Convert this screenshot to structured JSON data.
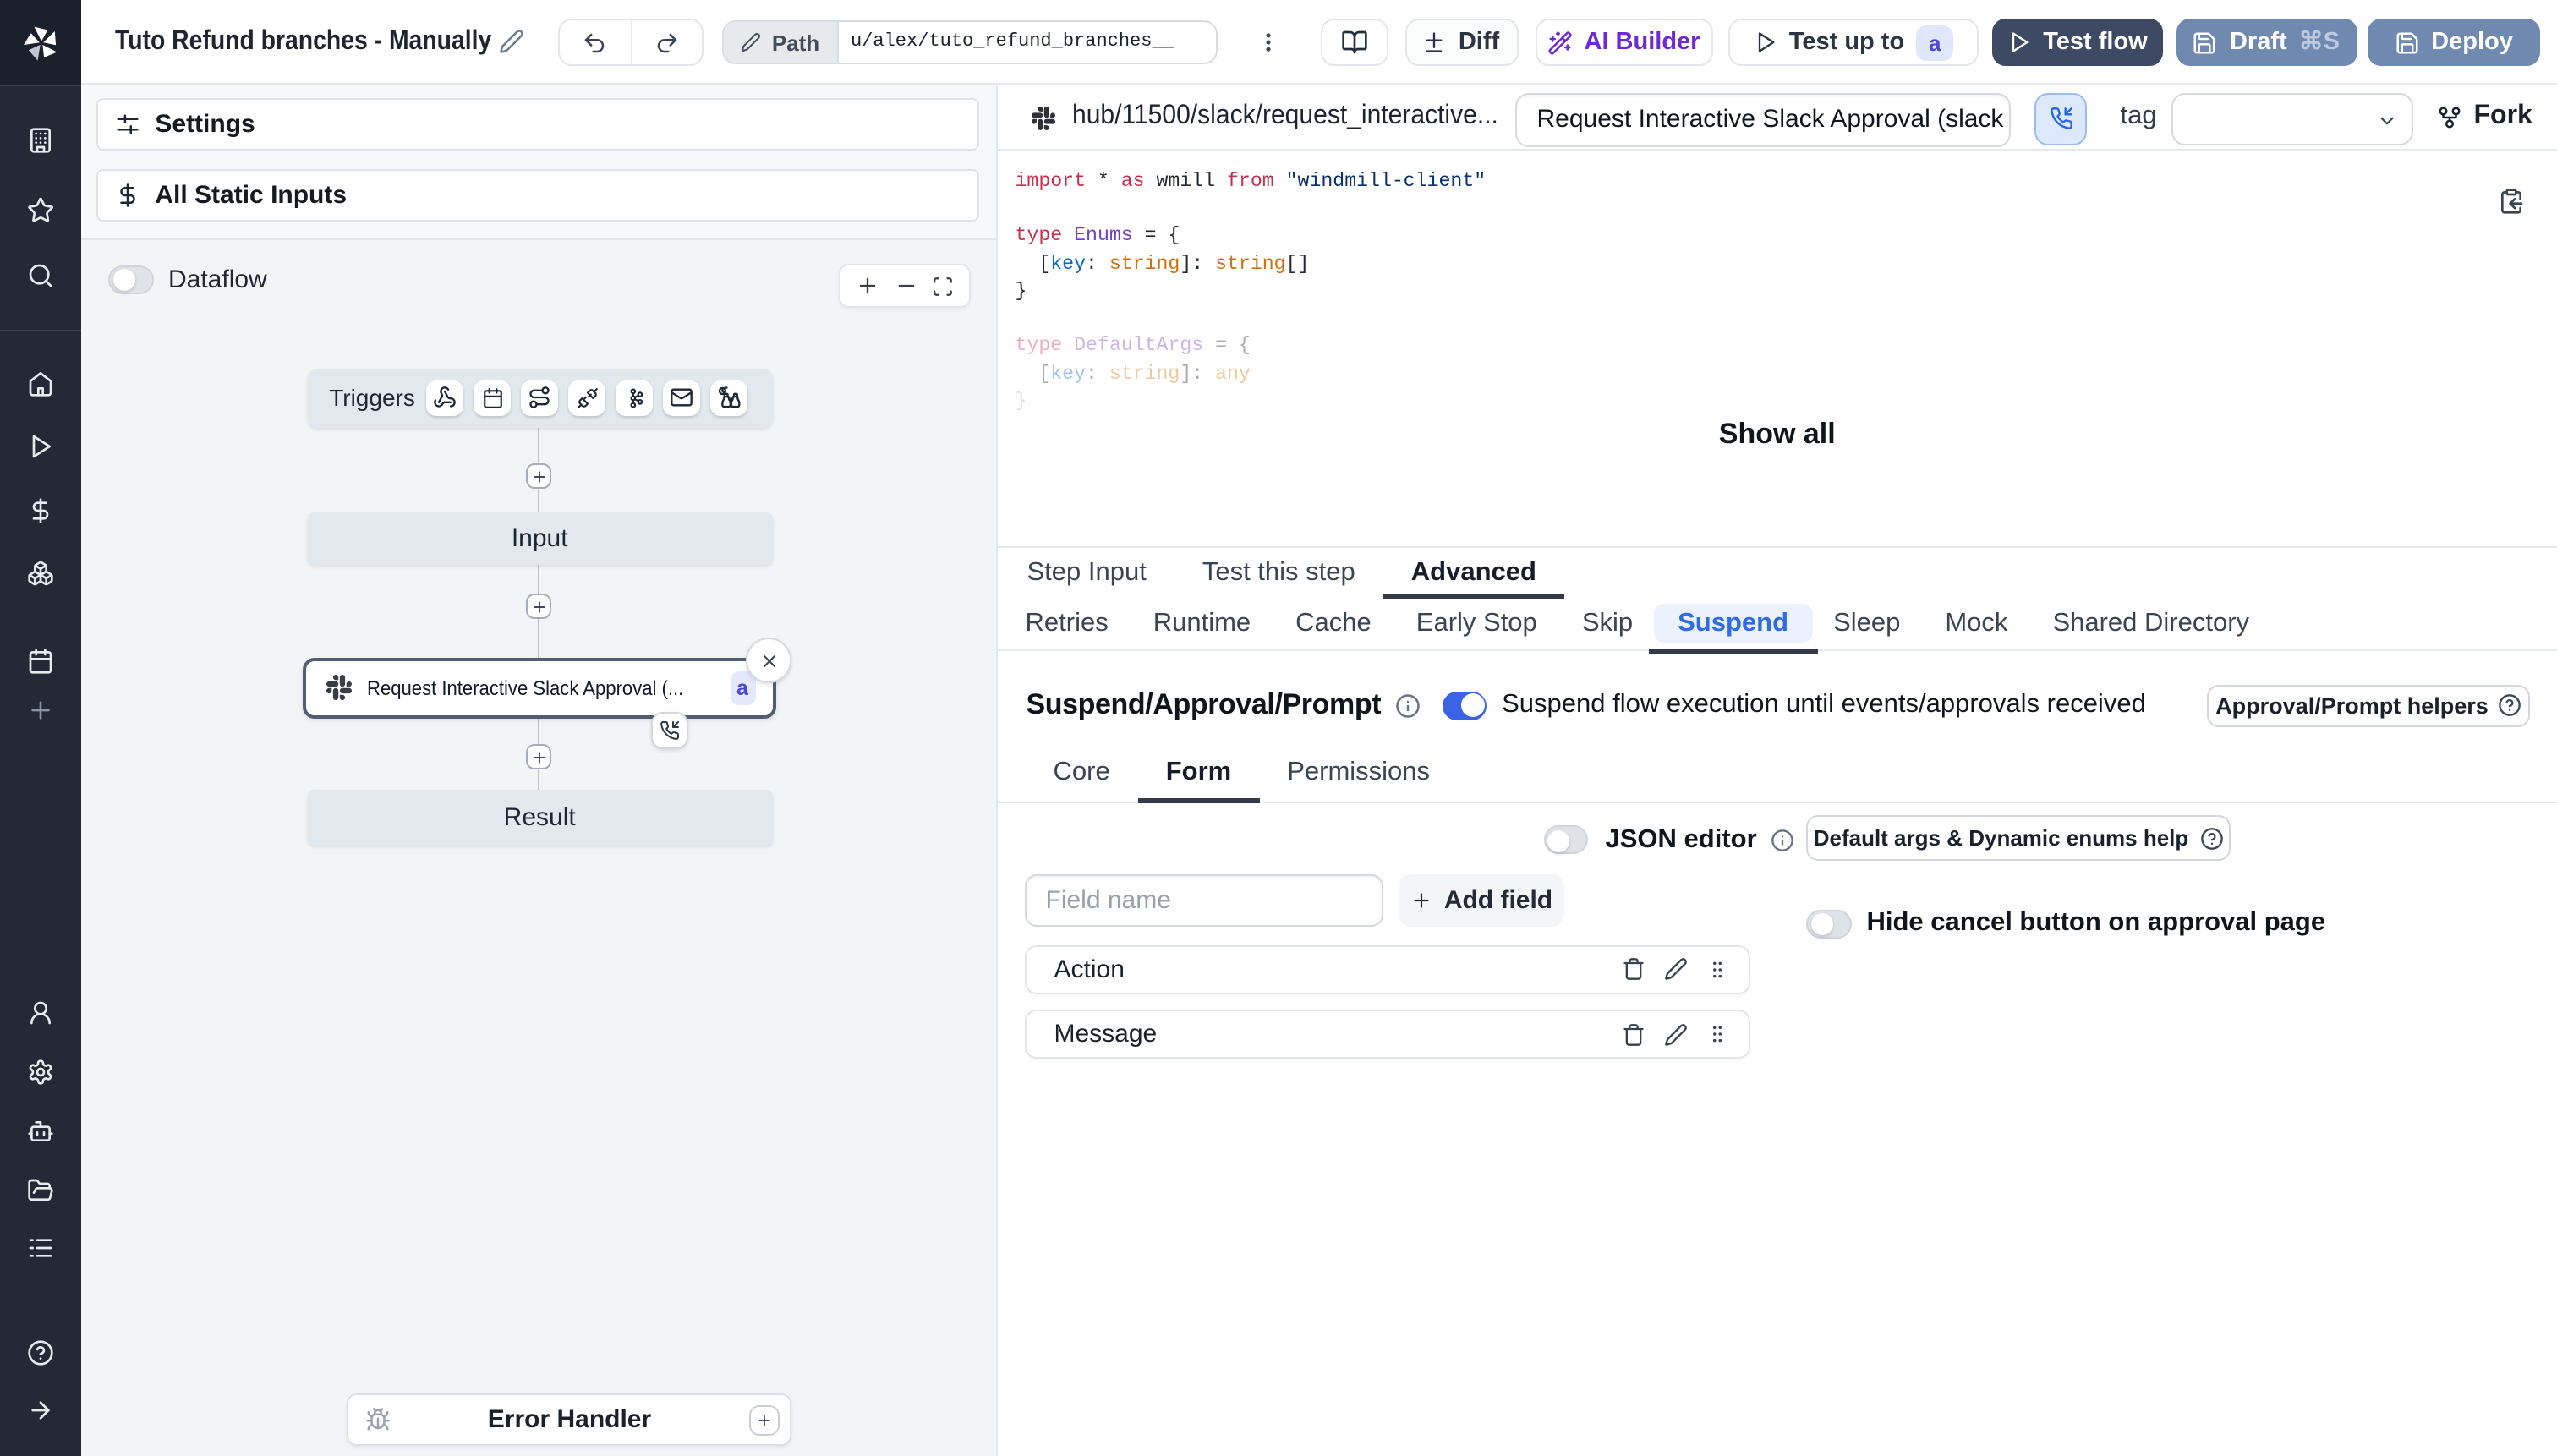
{
  "colors": {
    "accent_blue": "#3b63e5",
    "suspend_active": "#2f6be4",
    "test_flow_bg": "#3e4964",
    "draft_deploy_bg": "#7089b0",
    "sidebar_bg": "#242a35",
    "badge_indigo": "#4b48d6",
    "ai_purple": "#6d28d9"
  },
  "sidebar": {
    "items": [
      "windmill-logo",
      "workspace",
      "favorites",
      "search",
      "home",
      "runs",
      "variables",
      "resources",
      "schedules",
      "add",
      "user",
      "settings",
      "workers",
      "folders",
      "logs",
      "help",
      "expand"
    ]
  },
  "topbar": {
    "title": "Tuto Refund branches - Manually",
    "path_label": "Path",
    "path_value": "u/alex/tuto_refund_branches__",
    "diff": "Diff",
    "ai_builder": "AI Builder",
    "test_up_to": "Test up to",
    "test_up_to_badge": "a",
    "test_flow": "Test flow",
    "draft": "Draft",
    "draft_shortcut": "⌘S",
    "deploy": "Deploy"
  },
  "flow_panel": {
    "settings": "Settings",
    "all_static_inputs": "All Static Inputs",
    "dataflow": "Dataflow",
    "triggers_label": "Triggers",
    "trigger_icons": [
      "webhook",
      "schedule",
      "http-route",
      "websocket",
      "kafka",
      "email",
      "scheduled-poll"
    ],
    "input_node": "Input",
    "step_node": {
      "label": "Request Interactive Slack Approval (...",
      "badge": "a"
    },
    "result_node": "Result",
    "error_handler": "Error Handler"
  },
  "right_panel": {
    "hub_path": "hub/11500/slack/request_interactive...",
    "step_name": "Request Interactive Slack Approval (slack",
    "tag_label": "tag",
    "fork": "Fork",
    "show_all": "Show all",
    "code_lines": [
      {
        "fade": "none",
        "tokens": [
          {
            "t": "import",
            "c": "tk-k"
          },
          {
            "t": " * ",
            "c": "tk-d"
          },
          {
            "t": "as",
            "c": "tk-k"
          },
          {
            "t": " wmill ",
            "c": "tk-d"
          },
          {
            "t": "from",
            "c": "tk-k"
          },
          {
            "t": " ",
            "c": "tk-d"
          },
          {
            "t": "\"windmill-client\"",
            "c": "tk-s"
          }
        ]
      },
      {
        "fade": "none",
        "tokens": []
      },
      {
        "fade": "none",
        "tokens": [
          {
            "t": "type",
            "c": "tk-k"
          },
          {
            "t": " ",
            "c": "tk-d"
          },
          {
            "t": "Enums",
            "c": "tk-t"
          },
          {
            "t": " = {",
            "c": "tk-d"
          }
        ]
      },
      {
        "fade": "none",
        "tokens": [
          {
            "t": "  [",
            "c": "tk-d"
          },
          {
            "t": "key",
            "c": "tk-b"
          },
          {
            "t": ": ",
            "c": "tk-d"
          },
          {
            "t": "string",
            "c": "tk-o"
          },
          {
            "t": "]: ",
            "c": "tk-d"
          },
          {
            "t": "string",
            "c": "tk-o"
          },
          {
            "t": "[]",
            "c": "tk-d"
          }
        ]
      },
      {
        "fade": "none",
        "tokens": [
          {
            "t": "}",
            "c": "tk-d"
          }
        ]
      },
      {
        "fade": "none",
        "tokens": []
      },
      {
        "fade": "faded",
        "tokens": [
          {
            "t": "type",
            "c": "tk-k"
          },
          {
            "t": " ",
            "c": "tk-d"
          },
          {
            "t": "DefaultArgs",
            "c": "tk-t"
          },
          {
            "t": " = {",
            "c": "tk-d"
          }
        ]
      },
      {
        "fade": "faded",
        "tokens": [
          {
            "t": "  [",
            "c": "tk-d"
          },
          {
            "t": "key",
            "c": "tk-b"
          },
          {
            "t": ": ",
            "c": "tk-d"
          },
          {
            "t": "string",
            "c": "tk-o"
          },
          {
            "t": "]: ",
            "c": "tk-d"
          },
          {
            "t": "any",
            "c": "tk-o"
          }
        ]
      },
      {
        "fade": "xfaded",
        "tokens": [
          {
            "t": "}",
            "c": "tk-d"
          }
        ]
      }
    ],
    "tabs_primary": [
      {
        "label": "Step Input",
        "active": false
      },
      {
        "label": "Test this step",
        "active": false
      },
      {
        "label": "Advanced",
        "active": true
      }
    ],
    "tabs_secondary": [
      {
        "label": "Retries",
        "active": false
      },
      {
        "label": "Runtime",
        "active": false
      },
      {
        "label": "Cache",
        "active": false
      },
      {
        "label": "Early Stop",
        "active": false
      },
      {
        "label": "Skip",
        "active": false
      },
      {
        "label": "Suspend",
        "active": true
      },
      {
        "label": "Sleep",
        "active": false
      },
      {
        "label": "Mock",
        "active": false
      },
      {
        "label": "Shared Directory",
        "active": false
      }
    ],
    "suspend": {
      "heading": "Suspend/Approval/Prompt",
      "toggle_caption": "Suspend flow execution until events/approvals received",
      "helpers_button": "Approval/Prompt helpers",
      "tabs": [
        {
          "label": "Core",
          "active": false
        },
        {
          "label": "Form",
          "active": true
        },
        {
          "label": "Permissions",
          "active": false
        }
      ],
      "json_editor": "JSON editor",
      "default_args_help": "Default args & Dynamic enums help",
      "field_placeholder": "Field name",
      "add_field": "Add field",
      "hide_cancel": "Hide cancel button on approval page",
      "fields": [
        "Action",
        "Message"
      ]
    }
  }
}
